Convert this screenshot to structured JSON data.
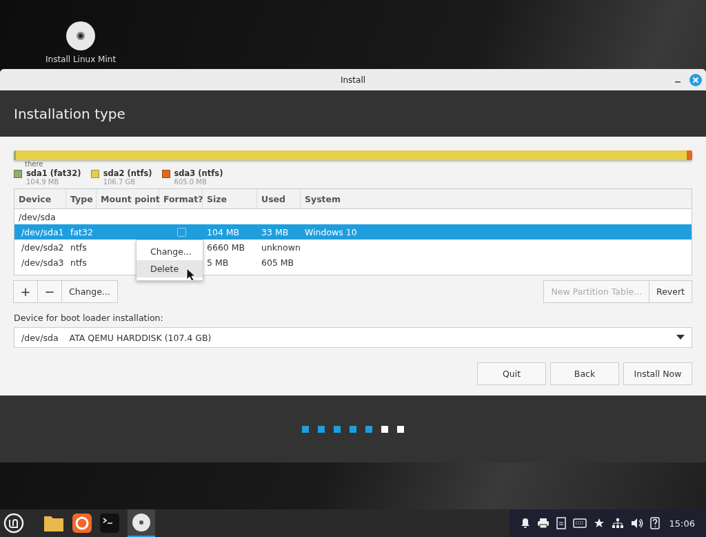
{
  "desktop": {
    "icons": [
      {
        "label": "Install Linux Mint"
      }
    ]
  },
  "window": {
    "title": "Install",
    "heading": "Installation type"
  },
  "partition_bar": {
    "overlay_text": "there",
    "segments": [
      {
        "name": "sda1 (fat32)",
        "size": "104.9 MB",
        "color": "#8fae6a",
        "level": 0.002
      },
      {
        "name": "sda2 (ntfs)",
        "size": "106.7 GB",
        "color": "#e6cf4a",
        "level": 0.99
      },
      {
        "name": "sda3 (ntfs)",
        "size": "605.0 MB",
        "color": "#e06a1c",
        "level": 0.008
      }
    ]
  },
  "table": {
    "columns": [
      "Device",
      "Type",
      "Mount point",
      "Format?",
      "Size",
      "Used",
      "System"
    ],
    "rows": [
      {
        "device": "/dev/sda",
        "selected": false,
        "children": [
          {
            "device": "/dev/sda1",
            "type": "fat32",
            "format": false,
            "size": "104 MB",
            "used": "33 MB",
            "system": "Windows 10",
            "selected": true
          },
          {
            "device": "/dev/sda2",
            "type": "ntfs",
            "size": "6660 MB",
            "used": "unknown",
            "selected": false
          },
          {
            "device": "/dev/sda3",
            "type": "ntfs",
            "size": "5 MB",
            "used": "605 MB",
            "selected": false
          }
        ]
      }
    ]
  },
  "context_menu": {
    "items": [
      {
        "label": "Change...",
        "selected": false
      },
      {
        "label": "Delete",
        "selected": true
      }
    ]
  },
  "toolbar": {
    "add": "+",
    "remove": "−",
    "change": "Change...",
    "new_table": {
      "label": "New Partition Table...",
      "disabled": true
    },
    "revert": {
      "label": "Revert",
      "disabled": false
    }
  },
  "boot_loader": {
    "label": "Device for boot loader installation:",
    "device": "/dev/sda",
    "description": "ATA QEMU HARDDISK (107.4 GB)"
  },
  "buttons": [
    "Quit",
    "Back",
    "Install Now"
  ],
  "steps": [
    {
      "done": true
    },
    {
      "done": true
    },
    {
      "done": true
    },
    {
      "done": true
    },
    {
      "done": true
    },
    {
      "done": false
    },
    {
      "done": false
    }
  ],
  "taskbar": {
    "clock": "15:06"
  }
}
